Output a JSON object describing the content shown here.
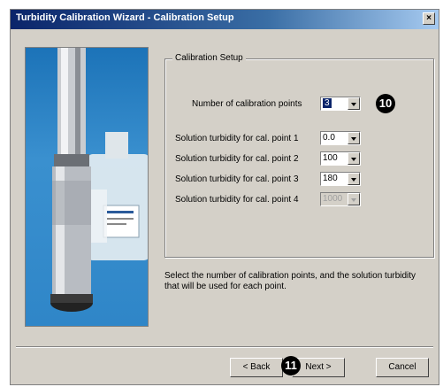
{
  "window": {
    "title": "Turbidity Calibration Wizard - Calibration Setup",
    "close_glyph": "×"
  },
  "group": {
    "legend": "Calibration Setup",
    "num_points_label": "Number of calibration points",
    "num_points_value": "3",
    "points": [
      {
        "label": "Solution turbidity for cal. point 1",
        "value": "0.0",
        "enabled": true
      },
      {
        "label": "Solution turbidity for cal. point 2",
        "value": "100",
        "enabled": true
      },
      {
        "label": "Solution turbidity for cal. point 3",
        "value": "180",
        "enabled": true
      },
      {
        "label": "Solution turbidity for cal. point 4",
        "value": "1000",
        "enabled": false
      }
    ]
  },
  "description": "Select the number of calibration points, and the solution turbidity that will be used for each point.",
  "buttons": {
    "back": "< Back",
    "next": "Next >",
    "cancel": "Cancel"
  },
  "callouts": {
    "step_10": "10",
    "step_11": "11"
  },
  "colors": {
    "title_bar": "#0a246a",
    "dialog_bg": "#d4d0c8",
    "image_bg": "#2f86c8",
    "selection": "#0a246a"
  }
}
